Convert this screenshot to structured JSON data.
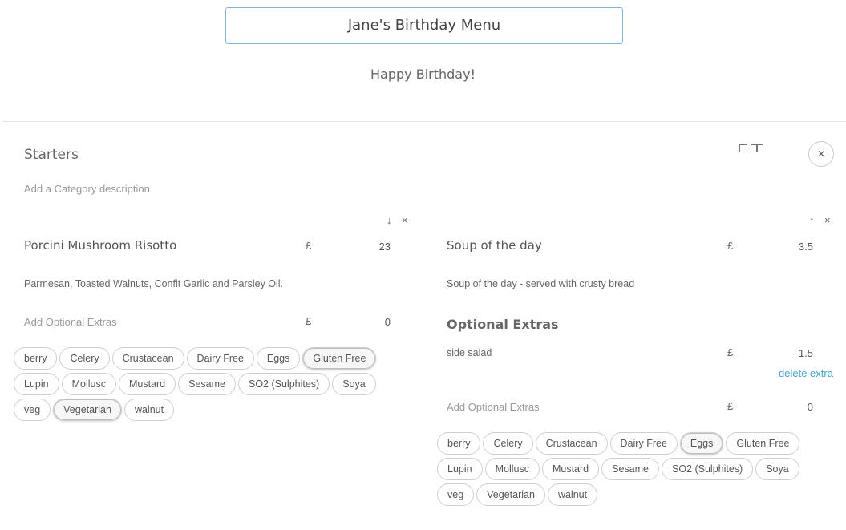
{
  "menu": {
    "title": "Jane's Birthday Menu",
    "subtitle": "Happy Birthday!"
  },
  "category": {
    "title": "Starters",
    "description_placeholder": "Add a Category description",
    "close_icon": "×"
  },
  "currency": "£",
  "icons": {
    "move_down": "↓",
    "move_up": "↑",
    "delete": "×"
  },
  "items": [
    {
      "name": "Porcini Mushroom Risotto",
      "price": "23",
      "description": "Parmesan, Toasted Walnuts, Confit Garlic and Parsley Oil.",
      "add_extras_placeholder": "Add Optional Extras",
      "add_extras_price": "0",
      "tags": [
        {
          "label": "berry",
          "selected": false
        },
        {
          "label": "Celery",
          "selected": false
        },
        {
          "label": "Crustacean",
          "selected": false
        },
        {
          "label": "Dairy Free",
          "selected": false
        },
        {
          "label": "Eggs",
          "selected": false
        },
        {
          "label": "Gluten Free",
          "selected": true
        },
        {
          "label": "Lupin",
          "selected": false
        },
        {
          "label": "Mollusc",
          "selected": false
        },
        {
          "label": "Mustard",
          "selected": false
        },
        {
          "label": "Sesame",
          "selected": false
        },
        {
          "label": "SO2 (Sulphites)",
          "selected": false
        },
        {
          "label": "Soya",
          "selected": false
        },
        {
          "label": "veg",
          "selected": false
        },
        {
          "label": "Vegetarian",
          "selected": true
        },
        {
          "label": "walnut",
          "selected": false
        }
      ]
    },
    {
      "name": "Soup of the day",
      "price": "3.5",
      "description": "Soup of the day - served with crusty bread",
      "extras_heading": "Optional Extras",
      "extras": [
        {
          "name": "side salad",
          "price": "1.5",
          "delete_label": "delete extra"
        }
      ],
      "add_extras_placeholder": "Add Optional Extras",
      "add_extras_price": "0",
      "tags": [
        {
          "label": "berry",
          "selected": false
        },
        {
          "label": "Celery",
          "selected": false
        },
        {
          "label": "Crustacean",
          "selected": false
        },
        {
          "label": "Dairy Free",
          "selected": false
        },
        {
          "label": "Eggs",
          "selected": true
        },
        {
          "label": "Gluten Free",
          "selected": false
        },
        {
          "label": "Lupin",
          "selected": false
        },
        {
          "label": "Mollusc",
          "selected": false
        },
        {
          "label": "Mustard",
          "selected": false
        },
        {
          "label": "Sesame",
          "selected": false
        },
        {
          "label": "SO2 (Sulphites)",
          "selected": false
        },
        {
          "label": "Soya",
          "selected": false
        },
        {
          "label": "veg",
          "selected": false
        },
        {
          "label": "Vegetarian",
          "selected": false
        },
        {
          "label": "walnut",
          "selected": false
        }
      ]
    }
  ]
}
